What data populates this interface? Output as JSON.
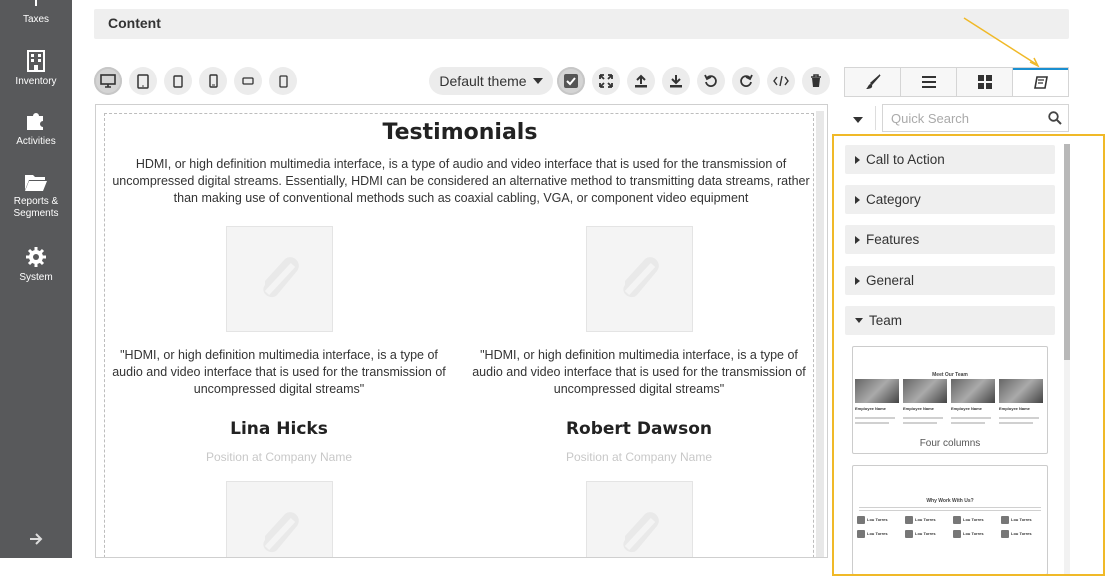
{
  "sidebar": {
    "items": [
      {
        "label": "Taxes",
        "icon": "taxes-icon"
      },
      {
        "label": "Inventory",
        "icon": "building-icon"
      },
      {
        "label": "Activities",
        "icon": "puzzle-icon"
      },
      {
        "label": "Reports &",
        "label2": "Segments",
        "icon": "folder-icon"
      },
      {
        "label": "System",
        "icon": "gear-icon"
      }
    ],
    "expand_icon": "arrow-right-icon"
  },
  "header": {
    "title": "Content"
  },
  "toolbar": {
    "devices": [
      "desktop-icon",
      "tablet-landscape-icon",
      "tablet-icon",
      "mobile-landscape-icon",
      "mobile-small-landscape-icon",
      "mobile-icon"
    ],
    "theme_select": "Default theme",
    "actions": [
      "toggle-borders-icon",
      "fullscreen-icon",
      "upload-icon",
      "download-icon",
      "undo-icon",
      "redo-icon",
      "code-icon",
      "trash-icon"
    ]
  },
  "right_tabs": [
    "brush-icon",
    "layers-icon",
    "blocks-grid-icon",
    "book-icon"
  ],
  "canvas": {
    "title": "Testimonials",
    "intro": "HDMI, or high definition multimedia interface, is a type of audio and video interface that is used for the transmission of uncompressed digital streams. Essentially, HDMI can be considered an alternative method to transmitting data streams, rather than making use of conventional methods such as coaxial cabling, VGA, or component video equipment",
    "testimonials": [
      {
        "quote": "\"HDMI, or high definition multimedia interface, is a type of audio and video interface that is used for the transmission of uncompressed digital streams\"",
        "name": "Lina Hicks",
        "position": "Position at Company Name"
      },
      {
        "quote": "\"HDMI, or high definition multimedia interface, is a type of audio and video interface that is used for the transmission of uncompressed digital streams\"",
        "name": "Robert Dawson",
        "position": "Position at Company Name"
      }
    ]
  },
  "search": {
    "placeholder": "Quick Search"
  },
  "blocks": {
    "categories": [
      {
        "label": "Call to Action",
        "expanded": false
      },
      {
        "label": "Category",
        "expanded": false
      },
      {
        "label": "Features",
        "expanded": false
      },
      {
        "label": "General",
        "expanded": false
      },
      {
        "label": "Team",
        "expanded": true
      }
    ],
    "team_cards": [
      {
        "caption": "Four columns",
        "mini_title": "Meet Our Team",
        "mini_label": "Employee Name"
      },
      {
        "caption": "",
        "mini_title": "Why Work With Us?",
        "mini_label": "Lou Torres"
      }
    ]
  },
  "colors": {
    "sidebar_bg": "#58595b",
    "highlight": "#f0b928",
    "tab_accent": "#1a8fd0"
  }
}
